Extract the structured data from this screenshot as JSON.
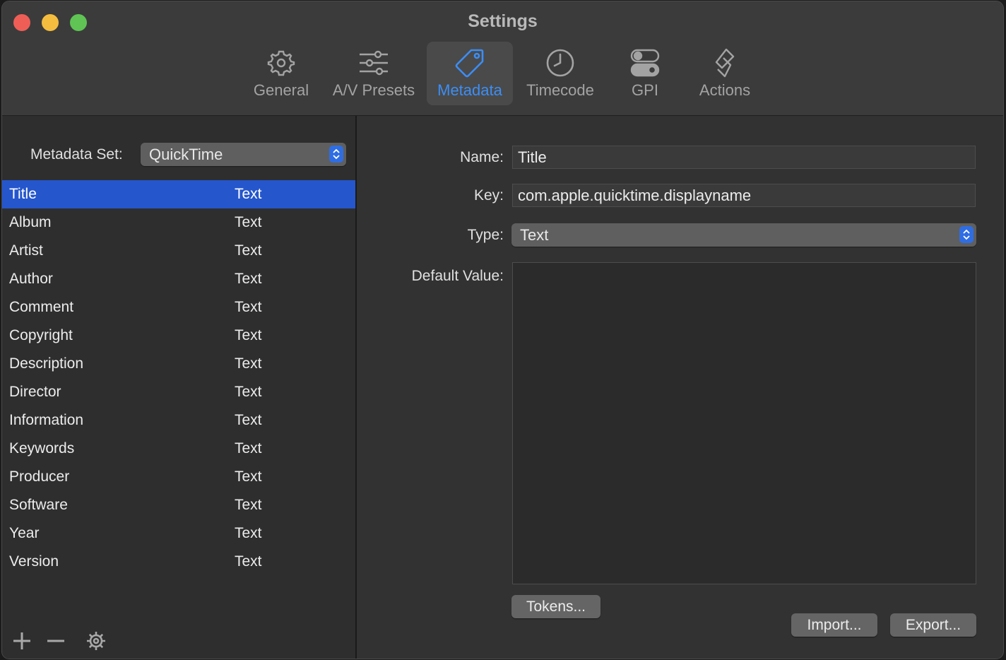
{
  "window": {
    "title": "Settings"
  },
  "toolbar": {
    "tabs": [
      {
        "label": "General",
        "icon": "gear-icon"
      },
      {
        "label": "A/V Presets",
        "icon": "sliders-icon"
      },
      {
        "label": "Metadata",
        "icon": "tag-icon",
        "active": true
      },
      {
        "label": "Timecode",
        "icon": "clock-icon"
      },
      {
        "label": "GPI",
        "icon": "toggles-icon"
      },
      {
        "label": "Actions",
        "icon": "actions-icon"
      }
    ]
  },
  "sidebar": {
    "set_label": "Metadata Set:",
    "set_value": "QuickTime",
    "items": [
      {
        "name": "Title",
        "type": "Text",
        "selected": true
      },
      {
        "name": "Album",
        "type": "Text"
      },
      {
        "name": "Artist",
        "type": "Text"
      },
      {
        "name": "Author",
        "type": "Text"
      },
      {
        "name": "Comment",
        "type": "Text"
      },
      {
        "name": "Copyright",
        "type": "Text"
      },
      {
        "name": "Description",
        "type": "Text"
      },
      {
        "name": "Director",
        "type": "Text"
      },
      {
        "name": "Information",
        "type": "Text"
      },
      {
        "name": "Keywords",
        "type": "Text"
      },
      {
        "name": "Producer",
        "type": "Text"
      },
      {
        "name": "Software",
        "type": "Text"
      },
      {
        "name": "Year",
        "type": "Text"
      },
      {
        "name": "Version",
        "type": "Text"
      }
    ]
  },
  "detail": {
    "name_label": "Name:",
    "name_value": "Title",
    "key_label": "Key:",
    "key_value": "com.apple.quicktime.displayname",
    "type_label": "Type:",
    "type_value": "Text",
    "default_label": "Default Value:",
    "default_value": "",
    "tokens_button": "Tokens...",
    "import_button": "Import...",
    "export_button": "Export..."
  },
  "colors": {
    "accent": "#3c8ef5",
    "selection": "#2556cc",
    "close": "#ee5e57",
    "minimize": "#f4bd3f",
    "maximize": "#5fc454"
  }
}
